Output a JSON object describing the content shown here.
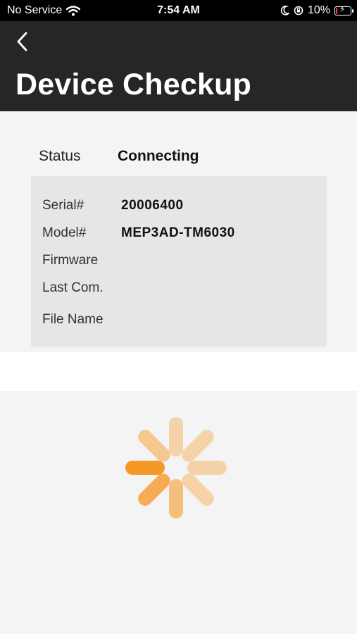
{
  "status_bar": {
    "carrier": "No Service",
    "time": "7:54 AM",
    "battery_percent": "10%",
    "battery_level": 0.1,
    "battery_color": "#ff3b30"
  },
  "header": {
    "title": "Device Checkup",
    "back_icon": "chevron-left-icon"
  },
  "status": {
    "label": "Status",
    "value": "Connecting"
  },
  "device_info": {
    "rows": [
      {
        "label": "Serial#",
        "value": "20006400"
      },
      {
        "label": "Model#",
        "value": "MEP3AD-TM6030"
      },
      {
        "label": "Firmware",
        "value": ""
      },
      {
        "label": "Last Com.",
        "value": ""
      },
      {
        "label": "File Name",
        "value": ""
      }
    ]
  },
  "loading": {
    "icon": "loading-spinner-icon",
    "accent_color": "#f7941d"
  }
}
